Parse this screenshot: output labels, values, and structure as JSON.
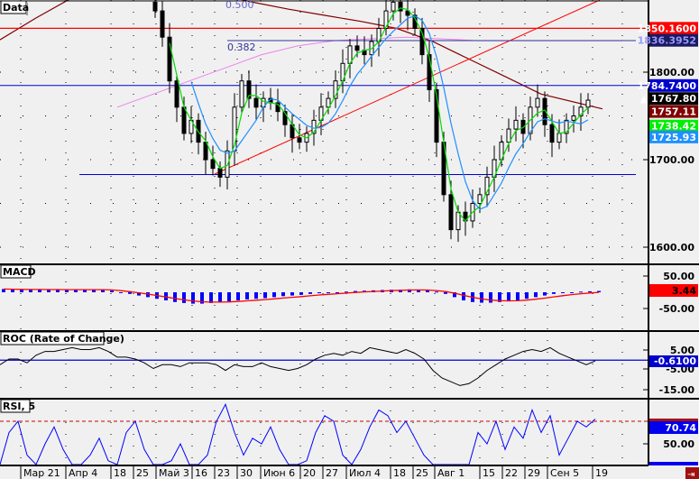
{
  "panels": {
    "main_title": "Data",
    "macd_title": "MACD",
    "roc_title": "ROC (Rate of Change)",
    "rsi_title": "RSI, 5"
  },
  "fib": {
    "level_500": "0.500",
    "level_382": "0.382"
  },
  "colors": {
    "bg": "#f0f0f0",
    "candle": "#000000",
    "ma_long": "#800000",
    "ma_fast": "#00dd00",
    "ma_mid": "#1e90ff",
    "ma_pink": "#ee82ee",
    "hline_red": "#ff0000",
    "hline_blue": "#0000cc",
    "macd_hist": "#0000ff",
    "macd_signal": "#ff0000"
  },
  "right_axis": {
    "main_ticks": [
      "1800.00",
      "1700.00",
      "1600.00"
    ],
    "main_tags": [
      {
        "text": "1850.1600",
        "bg": "#ff0000",
        "fg": "#ffffff",
        "price": 1850.16
      },
      {
        "text": "1836.3952",
        "bg": "#1a1a60",
        "fg": "#9999ff",
        "price": 1836.4
      },
      {
        "text": "1784.7400",
        "bg": "#0000cc",
        "fg": "#ffffff",
        "price": 1784.74
      },
      {
        "text": "▲ 1767.80",
        "bg": "#000000",
        "fg": "#ffffff",
        "price": 1767.8
      },
      {
        "text": "1757.11",
        "bg": "#800000",
        "fg": "#ffffff",
        "price": 1757.11
      },
      {
        "text": "1738.42",
        "bg": "#00ee00",
        "fg": "#ffffff",
        "price": 1738.42
      },
      {
        "text": "1725.93",
        "bg": "#1e90ff",
        "fg": "#ffffff",
        "price": 1725.93
      }
    ],
    "macd_ticks": [
      "50.00",
      "-50.00"
    ],
    "macd_tag": "3.44",
    "roc_ticks": [
      "5.00",
      "-5.00",
      "-15.00"
    ],
    "roc_tag": "-0.6100",
    "rsi_ticks": [
      "50.00"
    ],
    "rsi_tag": "70.74"
  },
  "x_axis": [
    "Мар 21",
    "Апр 4",
    "18",
    "25",
    "Май 3",
    "16",
    "23",
    "30",
    "Июн 6",
    "20",
    "27",
    "Июл 4",
    "18",
    "25",
    "Авг 1",
    "15",
    "22",
    "29",
    "Сен 5",
    "19"
  ],
  "chart_data": {
    "type": "line",
    "title": "Data",
    "price_axis": {
      "ylim": [
        1585,
        1885
      ],
      "ticks": [
        1600,
        1700,
        1800
      ]
    },
    "closes": [
      1870,
      1840,
      1790,
      1760,
      1730,
      1745,
      1720,
      1700,
      1690,
      1680,
      1710,
      1760,
      1790,
      1770,
      1760,
      1770,
      1765,
      1755,
      1740,
      1725,
      1720,
      1730,
      1745,
      1760,
      1770,
      1790,
      1810,
      1830,
      1825,
      1820,
      1835,
      1850,
      1870,
      1880,
      1870,
      1865,
      1850,
      1820,
      1780,
      1720,
      1660,
      1620,
      1640,
      1630,
      1650,
      1660,
      1680,
      1700,
      1720,
      1735,
      1745,
      1730,
      1760,
      1770,
      1740,
      1720,
      1730,
      1745,
      1750,
      1760,
      1768
    ],
    "ma_long": [
      1837,
      1862,
      1885,
      1895,
      1900,
      1898,
      1890,
      1880,
      1872,
      1865,
      1858,
      1850,
      1835,
      1815,
      1795,
      1775,
      1758
    ],
    "ma_pink": [
      1760,
      1775,
      1790,
      1805,
      1820,
      1830,
      1836,
      1838,
      1840,
      1838,
      1836,
      1836,
      1836,
      1836,
      1836
    ],
    "hlines": [
      1850.16,
      1784.74,
      1683
    ],
    "macd_hist": [
      10,
      8,
      8,
      8,
      8,
      8,
      8,
      8,
      8,
      8,
      8,
      8,
      5,
      0,
      -5,
      -10,
      -15,
      -20,
      -25,
      -30,
      -33,
      -35,
      -35,
      -33,
      -30,
      -28,
      -25,
      -22,
      -20,
      -18,
      -15,
      -12,
      -10,
      -8,
      -5,
      -3,
      -2,
      0,
      2,
      4,
      5,
      6,
      7,
      8,
      8,
      9,
      8,
      6,
      2,
      -5,
      -15,
      -25,
      -30,
      -32,
      -32,
      -30,
      -28,
      -25,
      -20,
      -15,
      -10,
      -5,
      -2,
      0,
      2,
      3,
      4
    ],
    "roc": [
      -3,
      0,
      0,
      -2,
      2,
      4,
      4,
      5,
      6,
      5,
      5,
      6,
      4,
      1,
      1,
      0,
      -2,
      -5,
      -3,
      -3,
      -4,
      -2,
      -2,
      -2,
      -3,
      -6,
      -3,
      -4,
      -4,
      -2,
      -4,
      -5,
      -6,
      -5,
      -3,
      0,
      2,
      3,
      2,
      4,
      3,
      6,
      5,
      4,
      3,
      5,
      3,
      0,
      -6,
      -10,
      -12,
      -14,
      -13,
      -10,
      -6,
      -3,
      0,
      2,
      4,
      5,
      4,
      6,
      3,
      1,
      -1,
      -3,
      -1
    ],
    "rsi": [
      30,
      60,
      70,
      40,
      20,
      50,
      65,
      45,
      30,
      10,
      40,
      55,
      35,
      20,
      60,
      70,
      45,
      25,
      15,
      35,
      50,
      30,
      20,
      40,
      70,
      85,
      60,
      40,
      55,
      50,
      65,
      45,
      30,
      20,
      35,
      60,
      75,
      70,
      40,
      20,
      45,
      65,
      80,
      75,
      60,
      70,
      55,
      40,
      20,
      10,
      5,
      5,
      30,
      60,
      50,
      70,
      45,
      65,
      55,
      80,
      60,
      75,
      40,
      55,
      70,
      65,
      72
    ]
  }
}
